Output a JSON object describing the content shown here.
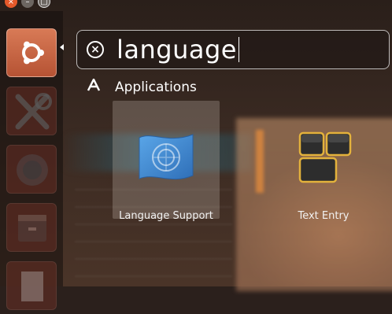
{
  "window_controls": {
    "close_glyph": "×",
    "min_glyph": "–",
    "max_glyph": "□"
  },
  "launcher": {
    "items": [
      {
        "name": "dash-home",
        "icon": "ubuntu-logo-icon"
      },
      {
        "name": "app-2",
        "icon": "tools-icon"
      },
      {
        "name": "app-3",
        "icon": "firefox-icon"
      },
      {
        "name": "app-4",
        "icon": "file-manager-icon"
      },
      {
        "name": "app-5",
        "icon": "document-icon"
      }
    ]
  },
  "search": {
    "value": "language",
    "clear_icon": "clear-circle-icon"
  },
  "category": {
    "label": "Applications",
    "icon": "applications-icon"
  },
  "results": [
    {
      "label": "Language Support",
      "icon": "language-support-flag-icon",
      "selected": true
    },
    {
      "label": "Text Entry",
      "icon": "keyboard-keys-icon",
      "selected": false
    }
  ],
  "colors": {
    "accent": "#dd4814",
    "launcher_home": "#c8603c",
    "key_outline": "#e3b23c"
  }
}
